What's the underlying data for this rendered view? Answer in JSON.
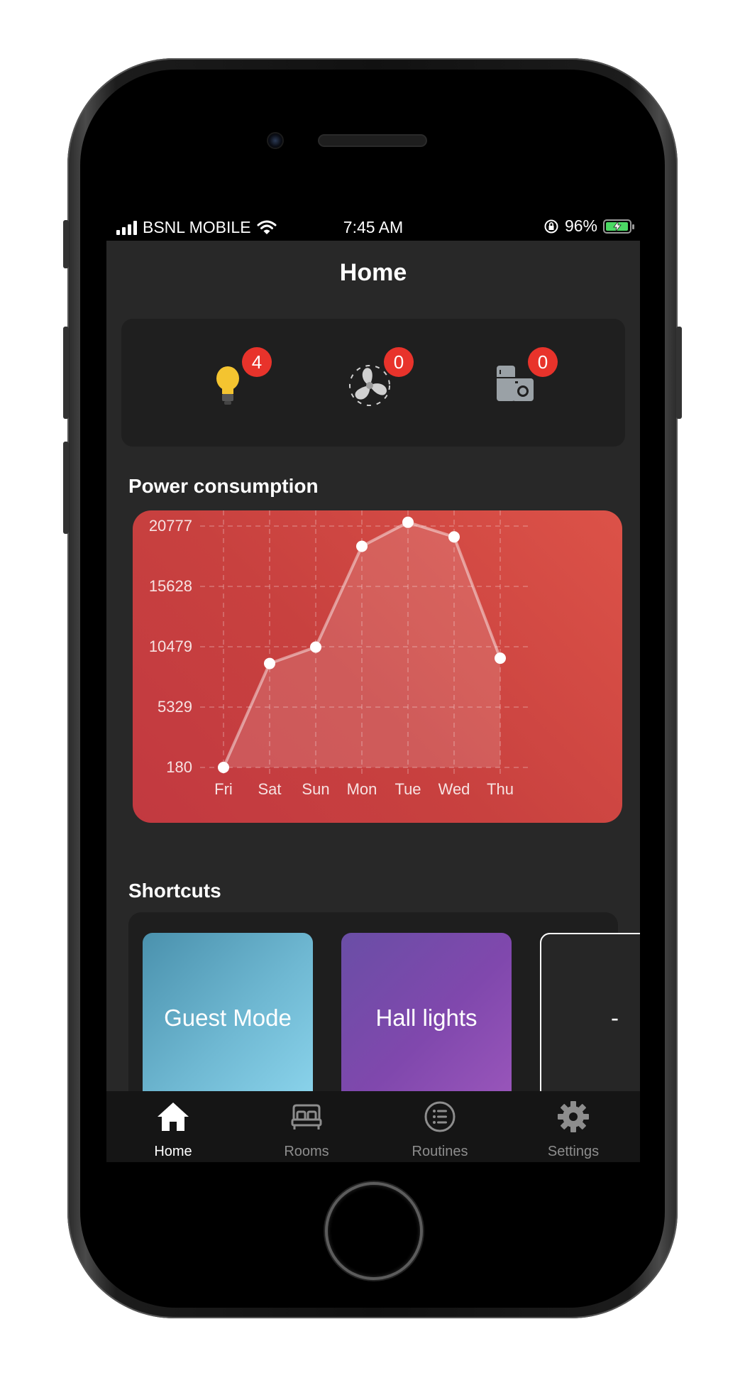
{
  "status_bar": {
    "carrier": "BSNL MOBILE",
    "time": "7:45 AM",
    "battery_percent": "96%",
    "battery_level": 0.96
  },
  "nav": {
    "title": "Home"
  },
  "devices": [
    {
      "name": "lights",
      "icon": "light-bulb-icon",
      "count": "4"
    },
    {
      "name": "fans",
      "icon": "fan-icon",
      "count": "0"
    },
    {
      "name": "appliances",
      "icon": "appliance-icon",
      "count": "0"
    }
  ],
  "power_section": {
    "title": "Power consumption"
  },
  "chart_data": {
    "type": "area",
    "categories": [
      "Fri",
      "Sat",
      "Sun",
      "Mon",
      "Tue",
      "Wed",
      "Thu"
    ],
    "series": [
      {
        "values": [
          180,
          9050,
          10450,
          19050,
          21100,
          19850,
          9500
        ]
      }
    ],
    "ytick_labels": [
      "20777",
      "15628",
      "10479",
      "5329",
      "180"
    ],
    "yticks": [
      20777,
      15628,
      10479,
      5329,
      180
    ],
    "ylim": [
      180,
      20777
    ],
    "grid": true,
    "colors": {
      "background": "#d4463f",
      "line": "#ffffff"
    }
  },
  "shortcuts_section": {
    "title": "Shortcuts"
  },
  "shortcuts": [
    {
      "label": "Guest Mode"
    },
    {
      "label": "Hall lights"
    },
    {
      "label": "-"
    }
  ],
  "tabs": [
    {
      "label": "Home",
      "icon": "home-icon",
      "active": true
    },
    {
      "label": "Rooms",
      "icon": "bed-icon",
      "active": false
    },
    {
      "label": "Routines",
      "icon": "list-icon",
      "active": false
    },
    {
      "label": "Settings",
      "icon": "gear-icon",
      "active": false
    }
  ]
}
